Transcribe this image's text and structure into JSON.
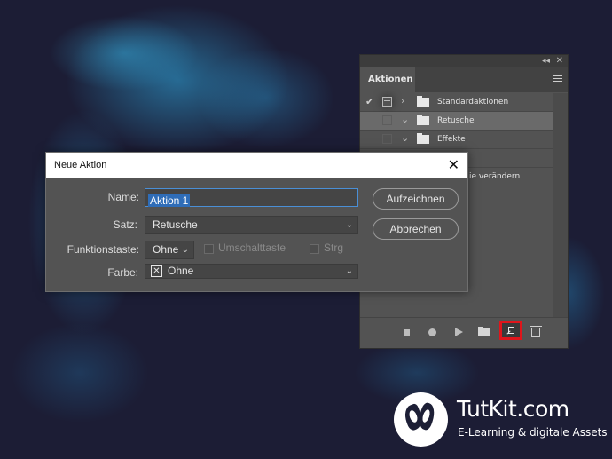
{
  "panel": {
    "tab_label": "Aktionen",
    "collapse_icon": "double-chevron-icon",
    "close_icon": "close-icon",
    "rows": [
      {
        "label": "Standardaktionen",
        "checked": true,
        "expanded": false
      },
      {
        "label": "Retusche",
        "checked": false,
        "expanded": true,
        "selected": true
      },
      {
        "label": "Effekte",
        "checked": false,
        "expanded": true
      },
      {
        "label": "",
        "checked": false
      },
      {
        "label": "ie verändern",
        "checked": false
      }
    ],
    "bottom_icons": [
      "stop-icon",
      "record-icon",
      "play-icon",
      "new-set-folder-icon",
      "new-action-icon",
      "trash-icon"
    ],
    "highlight_color": "#e0151b"
  },
  "dialog": {
    "title": "Neue Aktion",
    "name_label": "Name:",
    "name_value": "Aktion 1",
    "satz_label": "Satz:",
    "satz_value": "Retusche",
    "funktionstaste_label": "Funktionstaste:",
    "funktionstaste_value": "Ohne",
    "umschalttaste_label": "Umschalttaste",
    "strg_label": "Strg",
    "farbe_label": "Farbe:",
    "farbe_value": "Ohne",
    "record_button": "Aufzeichnen",
    "cancel_button": "Abbrechen"
  },
  "logo": {
    "name": "TutKit.com",
    "tagline": "E-Learning & digitale Assets"
  }
}
